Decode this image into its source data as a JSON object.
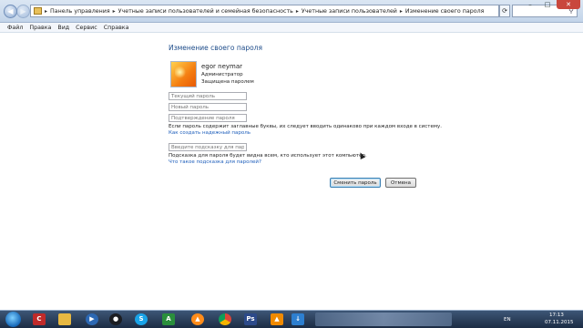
{
  "address_bar": {
    "crumbs": [
      "Панель управления",
      "Учетные записи пользователей и семейная безопасность",
      "Учетные записи пользователей",
      "Изменение своего пароля"
    ],
    "separator": "▸"
  },
  "menu": {
    "items": [
      "Файл",
      "Правка",
      "Вид",
      "Сервис",
      "Справка"
    ]
  },
  "page": {
    "title": "Изменение своего пароля",
    "user_name": "egor neymar",
    "user_role": "Администратор",
    "user_status": "Защищена паролем",
    "current_password_placeholder": "Текущий пароль",
    "new_password_placeholder": "Новый пароль",
    "confirm_password_placeholder": "Подтверждение пароля",
    "caps_note": "Если пароль содержит заглавные буквы, их следует вводить одинаково при каждом входе в систему.",
    "strong_password_link": "Как создать надежный пароль",
    "hint_placeholder": "Введите подсказку для пароля",
    "hint_note": "Подсказка для пароля будет видна всем, кто использует этот компьютер.",
    "hint_link": "Что такое подсказка для паролей?",
    "change_button": "Сменить пароль",
    "cancel_button": "Отмена"
  },
  "taskbar": {
    "language": "EN",
    "time": "17:13",
    "date": "07.11.2015",
    "apps": [
      "ccleaner-icon",
      "folder-icon",
      "media-player-icon",
      "steam-icon",
      "skype-icon",
      "windows-media-center-icon",
      "aimp-icon",
      "chrome-icon",
      "paint-icon",
      "photoshop-icon",
      "vlc-icon",
      "download-icon",
      "folder-icon",
      "blurred-window-icon"
    ]
  },
  "colors": {
    "accent": "#1e4c8a",
    "link": "#1e5ebb",
    "taskbar": "#1c2c44"
  }
}
